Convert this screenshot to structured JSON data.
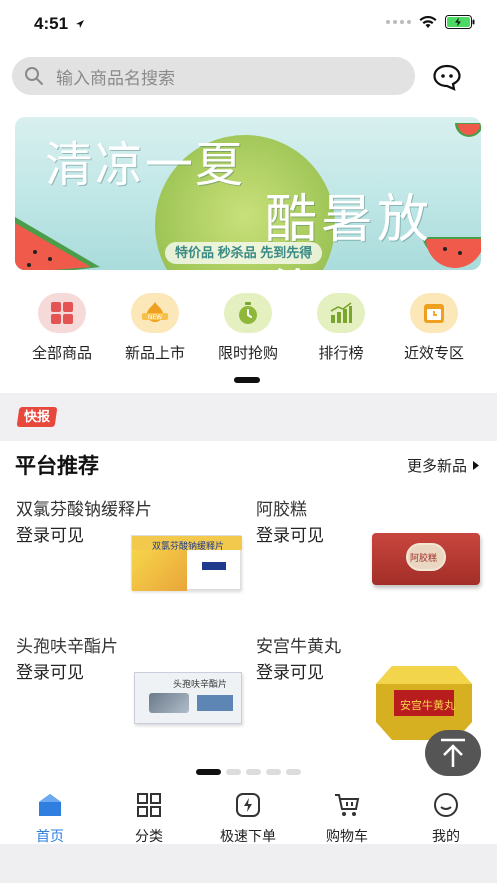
{
  "status_bar": {
    "time": "4:51"
  },
  "search": {
    "placeholder": "输入商品名搜索"
  },
  "banner": {
    "title_line1": "清凉一夏",
    "title_line2": "酷暑放价",
    "tagline": "特价品 秒杀品 先到先得"
  },
  "quick_menu": {
    "items": [
      {
        "label": "全部商品",
        "icon": "grid-icon",
        "color": "#f6d9d9"
      },
      {
        "label": "新品上市",
        "icon": "new-badge-icon",
        "color": "#fbe7b8"
      },
      {
        "label": "限时抢购",
        "icon": "timer-icon",
        "color": "#e4f0bf"
      },
      {
        "label": "排行榜",
        "icon": "chart-icon",
        "color": "#e4f0bf"
      },
      {
        "label": "近效专区",
        "icon": "calendar-icon",
        "color": "#fbe7b8"
      }
    ]
  },
  "news": {
    "tag": "快报"
  },
  "recommend": {
    "title": "平台推荐",
    "more_label": "更多新品",
    "products": [
      {
        "name": "双氯芬酸钠缓释片",
        "price": "登录可见",
        "box_text": "双氯芬酸钠缓释片"
      },
      {
        "name": "阿胶糕",
        "price": "登录可见",
        "box_text": "阿胶糕"
      },
      {
        "name": "头孢呋辛酯片",
        "price": "登录可见",
        "box_text": "头孢呋辛酯片"
      },
      {
        "name": "安宫牛黄丸",
        "price": "登录可见",
        "box_text": "安宫牛黄丸"
      }
    ]
  },
  "tab_bar": {
    "tabs": [
      {
        "label": "首页",
        "icon": "home-icon",
        "active": true
      },
      {
        "label": "分类",
        "icon": "category-icon",
        "active": false
      },
      {
        "label": "极速下单",
        "icon": "lightning-icon",
        "active": false
      },
      {
        "label": "购物车",
        "icon": "cart-icon",
        "active": false
      },
      {
        "label": "我的",
        "icon": "profile-icon",
        "active": false
      }
    ]
  },
  "colors": {
    "accent": "#2f7fe0",
    "news_tag": "#e8473c"
  }
}
